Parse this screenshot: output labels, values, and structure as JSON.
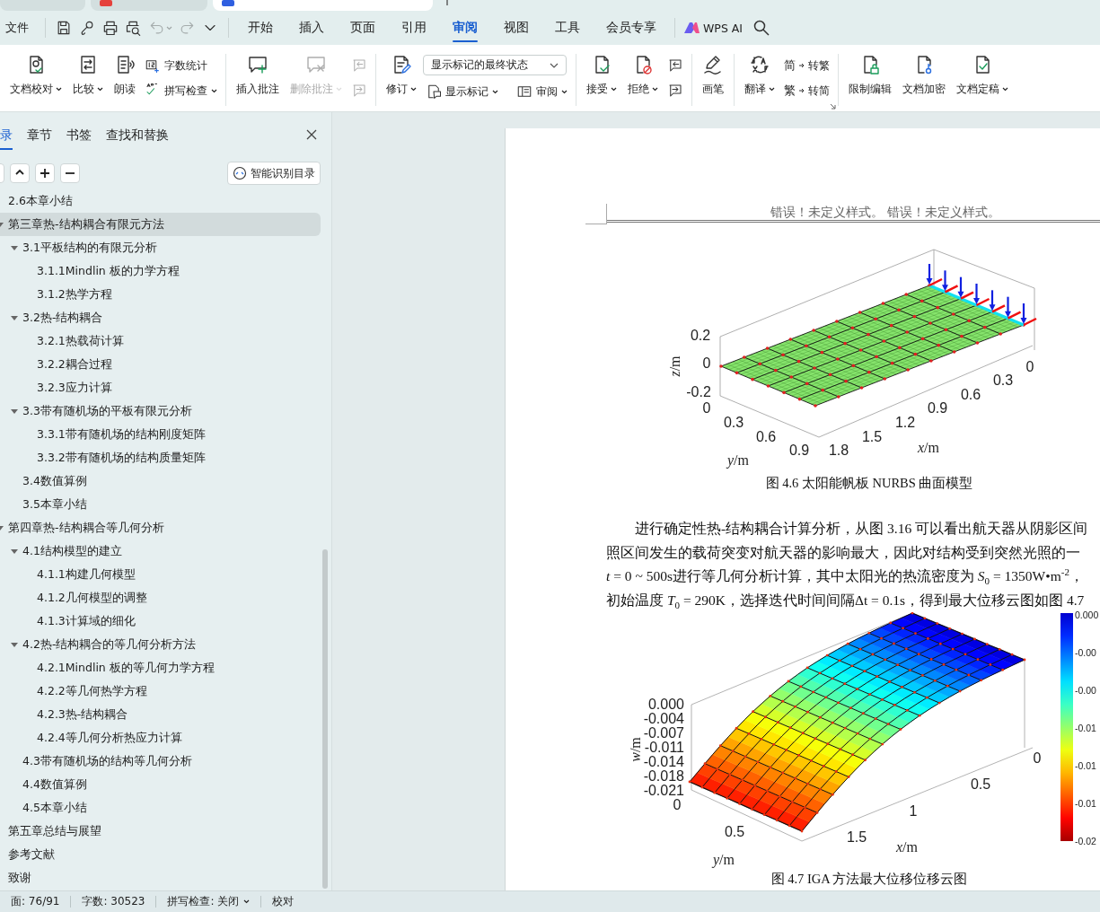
{
  "document_tabs": [
    {
      "kind": "plain",
      "selected": false
    },
    {
      "kind": "pdf",
      "selected": false
    },
    {
      "kind": "writer",
      "selected": true
    }
  ],
  "menu_bar": {
    "file": "文件",
    "quick_access": [
      {
        "kind": "save",
        "disabled": false
      },
      {
        "kind": "brush",
        "disabled": false
      },
      {
        "kind": "print",
        "disabled": false
      },
      {
        "kind": "preview",
        "disabled": false
      },
      {
        "kind": "undo",
        "disabled": true
      },
      {
        "kind": "redo",
        "disabled": true
      },
      {
        "kind": "more",
        "disabled": false
      }
    ],
    "tabs": [
      {
        "label": "开始",
        "selected": false
      },
      {
        "label": "插入",
        "selected": false
      },
      {
        "label": "页面",
        "selected": false
      },
      {
        "label": "引用",
        "selected": false
      },
      {
        "label": "审阅",
        "selected": true
      },
      {
        "label": "视图",
        "selected": false
      },
      {
        "label": "工具",
        "selected": false
      },
      {
        "label": "会员专享",
        "selected": false
      }
    ],
    "ai_label": "WPS AI"
  },
  "ribbon": {
    "groups": [
      {
        "items": [
          {
            "kind": "large",
            "label": "文档校对",
            "dropdown": true,
            "disabled": false
          },
          {
            "kind": "large",
            "label": "比较",
            "dropdown": true,
            "disabled": false
          },
          {
            "kind": "large",
            "label": "朗读",
            "dropdown": false,
            "disabled": false
          },
          {
            "kind": "stack",
            "items": [
              {
                "label": "字数统计",
                "dropdown": false,
                "disabled": false
              },
              {
                "label": "拼写检查",
                "dropdown": true,
                "disabled": false
              }
            ]
          }
        ]
      },
      {
        "items": [
          {
            "kind": "large",
            "label": "插入批注",
            "dropdown": false,
            "disabled": false
          },
          {
            "kind": "large",
            "label": "删除批注",
            "dropdown": true,
            "disabled": true
          },
          {
            "kind": "stack",
            "items": [
              {
                "dropdown": false,
                "disabled": true
              },
              {
                "dropdown": false,
                "disabled": true
              }
            ]
          }
        ]
      },
      {
        "items": [
          {
            "kind": "large",
            "label": "修订",
            "dropdown": true,
            "disabled": false
          },
          {
            "kind": "combo",
            "value": "显示标记的最终状态",
            "items": [
              {
                "label": "显示标记",
                "dropdown": true,
                "disabled": false
              },
              {
                "label": "审阅",
                "dropdown": true,
                "disabled": false
              }
            ]
          }
        ]
      },
      {
        "items": [
          {
            "kind": "large",
            "label": "接受",
            "dropdown": true,
            "disabled": false
          },
          {
            "kind": "large",
            "label": "拒绝",
            "dropdown": true,
            "disabled": false
          },
          {
            "kind": "stack",
            "items": [
              {
                "dropdown": false,
                "disabled": false
              },
              {
                "dropdown": false,
                "disabled": false
              }
            ]
          }
        ]
      },
      {
        "items": [
          {
            "kind": "large",
            "label": "画笔",
            "dropdown": false,
            "disabled": false
          }
        ]
      },
      {
        "launcher": true,
        "items": [
          {
            "kind": "large",
            "label": "翻译",
            "dropdown": true,
            "disabled": false
          },
          {
            "kind": "stack",
            "items": [
              {
                "icon_text": "简",
                "label": "转繁",
                "dropdown": false,
                "disabled": false
              },
              {
                "icon_text": "繁",
                "label": "转简",
                "dropdown": false,
                "disabled": false
              }
            ]
          }
        ]
      },
      {
        "items": [
          {
            "kind": "large",
            "label": "限制编辑",
            "dropdown": false,
            "disabled": false
          },
          {
            "kind": "large",
            "label": "文档加密",
            "dropdown": false,
            "disabled": false
          },
          {
            "kind": "large",
            "label": "文档定稿",
            "dropdown": true,
            "disabled": false
          }
        ]
      }
    ]
  },
  "nav_panel": {
    "tabs": [
      {
        "label": "录",
        "selected": true
      },
      {
        "label": "章节",
        "selected": false
      },
      {
        "label": "书签",
        "selected": false
      },
      {
        "label": "查找和替换",
        "selected": false
      }
    ],
    "tools": [
      {
        "kind": "cut"
      },
      {
        "kind": "up"
      },
      {
        "kind": "add"
      },
      {
        "kind": "remove"
      }
    ],
    "smart_button": "智能识别目录",
    "outline": [
      {
        "label": "2.6本章小结",
        "selected": false
      },
      {
        "label": "第三章热-结构耦合有限元方法",
        "selected": true,
        "expanded": true,
        "children": [
          {
            "label": "3.1平板结构的有限元分析",
            "selected": false,
            "expanded": true,
            "children": [
              {
                "label": "3.1.1Mindlin 板的力学方程",
                "selected": false
              },
              {
                "label": "3.1.2热学方程",
                "selected": false
              }
            ]
          },
          {
            "label": "3.2热-结构耦合",
            "selected": false,
            "expanded": true,
            "children": [
              {
                "label": "3.2.1热载荷计算",
                "selected": false
              },
              {
                "label": "3.2.2耦合过程",
                "selected": false
              },
              {
                "label": "3.2.3应力计算",
                "selected": false
              }
            ]
          },
          {
            "label": "3.3带有随机场的平板有限元分析",
            "selected": false,
            "expanded": true,
            "children": [
              {
                "label": "3.3.1带有随机场的结构刚度矩阵",
                "selected": false
              },
              {
                "label": "3.3.2带有随机场的结构质量矩阵",
                "selected": false
              }
            ]
          },
          {
            "label": "3.4数值算例",
            "selected": false
          },
          {
            "label": "3.5本章小结",
            "selected": false
          }
        ]
      },
      {
        "label": "第四章热-结构耦合等几何分析",
        "selected": false,
        "expanded": true,
        "children": [
          {
            "label": "4.1结构模型的建立",
            "selected": false,
            "expanded": true,
            "children": [
              {
                "label": "4.1.1构建几何模型",
                "selected": false
              },
              {
                "label": "4.1.2几何模型的调整",
                "selected": false
              },
              {
                "label": "4.1.3计算域的细化",
                "selected": false
              }
            ]
          },
          {
            "label": "4.2热-结构耦合的等几何分析方法",
            "selected": false,
            "expanded": true,
            "children": [
              {
                "label": "4.2.1Mindlin 板的等几何力学方程",
                "selected": false
              },
              {
                "label": "4.2.2等几何热学方程",
                "selected": false
              },
              {
                "label": "4.2.3热-结构耦合",
                "selected": false
              },
              {
                "label": "4.2.4等几何分析热应力计算",
                "selected": false
              }
            ]
          },
          {
            "label": "4.3带有随机场的结构等几何分析",
            "selected": false
          },
          {
            "label": "4.4数值算例",
            "selected": false
          },
          {
            "label": "4.5本章小结",
            "selected": false
          }
        ]
      },
      {
        "label": "第五章总结与展望",
        "selected": false
      },
      {
        "label": "参考文献",
        "selected": false
      },
      {
        "label": "致谢",
        "selected": false
      }
    ]
  },
  "document": {
    "header": "错误！未定义样式。 错误！未定义样式。",
    "blocks": [
      {
        "kind": "mesh",
        "z_label": "*z*/m",
        "y_label": "*y*/m",
        "x_label": "*x*/m",
        "z_ticks": [
          "0.2",
          "0",
          "-0.2"
        ],
        "y_ticks": [
          "0",
          "0.3",
          "0.6",
          "0.9"
        ],
        "x_ticks": [
          "1.8",
          "1.5",
          "1.2",
          "0.9",
          "0.6",
          "0.3",
          "0"
        ],
        "caption": "图 4.6  太阳能帆板 NURBS 曲面模型"
      },
      {
        "kind": "paragraph",
        "lines": [
          "进行确定性热-结构耦合计算分析，从图 3.16 可以看出航天器从阴影区间",
          "照区间发生的载荷突变对航天器的影响最大，因此对结构受到突然光照的一",
          "*t* = 0 ~ 500s进行等几何分析计算，其中太阳光的热流密度为 *S*$_{0}$ = 1350W•m$^{-2}$，",
          "初始温度 *T*$_{0}$ = 290K，选择迭代时间间隔Δt = 0.1s，得到最大位移云图如图 4.7"
        ]
      },
      {
        "kind": "surface",
        "z_label": "*w*/m",
        "y_label": "*y*/m",
        "x_label": "*x*/m",
        "z_ticks": [
          "0.000",
          "-0.004",
          "-0.007",
          "-0.011",
          "-0.014",
          "-0.018",
          "-0.021"
        ],
        "y_ticks": [
          "0",
          "0.5"
        ],
        "x_ticks": [
          "1.5",
          "1",
          "0.5",
          "0"
        ],
        "colorbar_ticks": [
          "0.000",
          "-0.00",
          "-0.00",
          "-0.01",
          "-0.01",
          "-0.01",
          "-0.02"
        ],
        "caption": "图 4.7  IGA 方法最大位移位移云图"
      }
    ]
  },
  "status_bar": {
    "items": [
      {
        "label": "面: 76/91",
        "dropdown": false
      },
      {
        "label": "字数: 30523",
        "dropdown": false
      },
      {
        "label": "拼写检查: 关闭",
        "dropdown": true
      },
      {
        "label": "校对",
        "dropdown": false
      }
    ]
  }
}
